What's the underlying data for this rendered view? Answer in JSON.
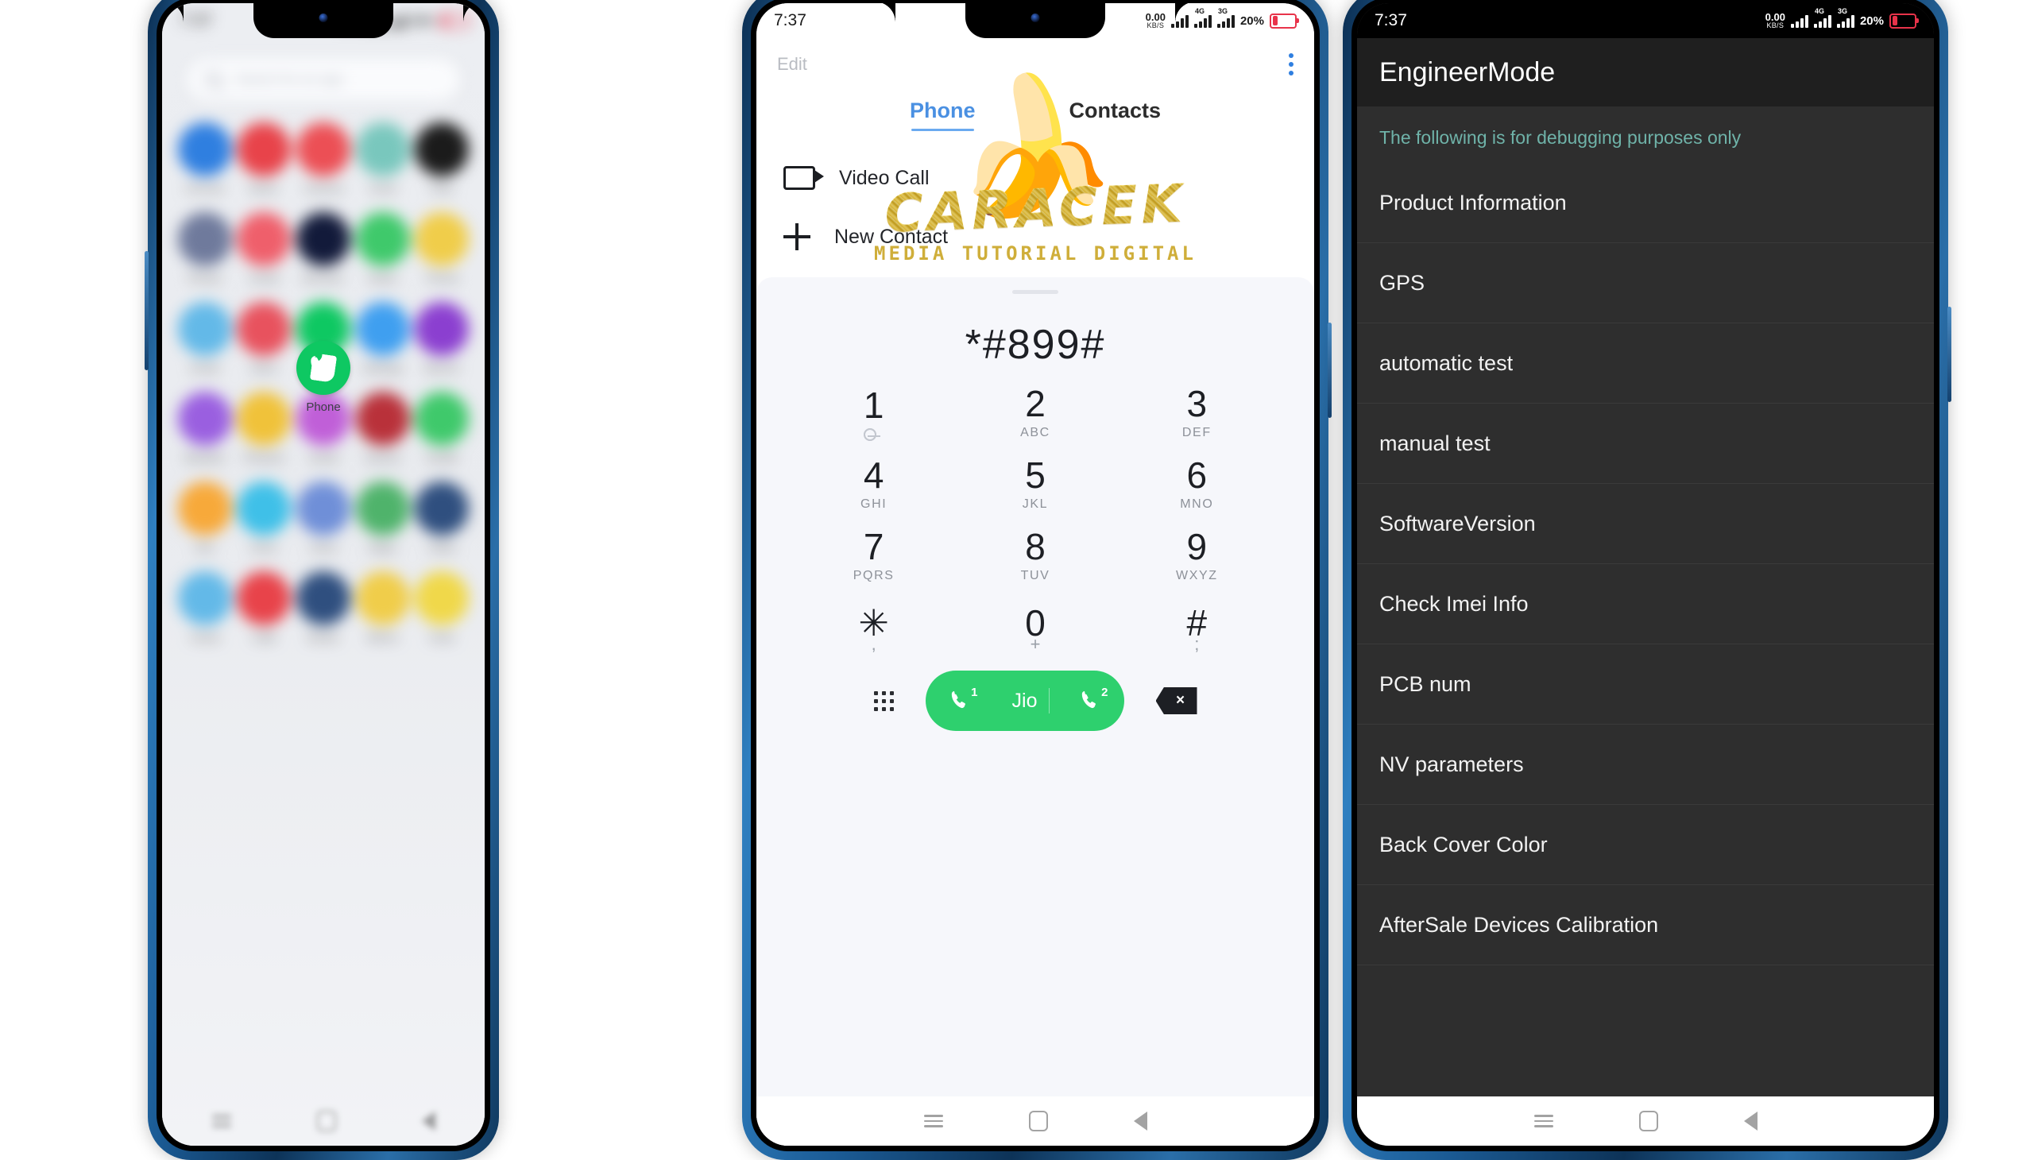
{
  "statusbar": {
    "time": "7:37",
    "data_rate_value": "0.00",
    "data_rate_unit": "KB/S",
    "battery_percent": "20%",
    "icons": [
      "data-speed-icon",
      "mobile-data-icon",
      "signal-sim1-icon",
      "signal-sim2-icon",
      "battery-icon"
    ],
    "signal1_gen": "4G",
    "signal2_gen": "3G"
  },
  "phone1": {
    "name": "app-drawer",
    "search_placeholder": "Search for an app",
    "apps": [
      {
        "label": "Chrome",
        "color": "#2f7fe0"
      },
      {
        "label": "Music",
        "color": "#e8434a"
      },
      {
        "label": "Camera",
        "color": "#ec4f55"
      },
      {
        "label": "Clock",
        "color": "#79c7bd"
      },
      {
        "label": "Files",
        "color": "#1b1b1b"
      },
      {
        "label": "Photos",
        "color": "#6f7a9c"
      },
      {
        "label": "Gmail",
        "color": "#ef5f6b"
      },
      {
        "label": "Browser",
        "color": "#121a3a"
      },
      {
        "label": "Notes",
        "color": "#3fc96b"
      },
      {
        "label": "Theme",
        "color": "#f0cd4a"
      },
      {
        "label": "Email",
        "color": "#63b9e8"
      },
      {
        "label": "Store",
        "color": "#e8525e"
      },
      {
        "label": "Phone",
        "color": "#0ec862"
      },
      {
        "label": "Settings",
        "color": "#3f9ff0"
      },
      {
        "label": "Music2",
        "color": "#8b3fd0"
      },
      {
        "label": "Weather",
        "color": "#9a5fe0"
      },
      {
        "label": "Photos2",
        "color": "#f0c23a"
      },
      {
        "label": "Assist",
        "color": "#c05fd8"
      },
      {
        "label": "Games",
        "color": "#b9313a"
      },
      {
        "label": "Health",
        "color": "#3fc96b"
      },
      {
        "label": "Sun",
        "color": "#f7a93a"
      },
      {
        "label": "Drive",
        "color": "#3fc0e8"
      },
      {
        "label": "Voice",
        "color": "#6f8fd8"
      },
      {
        "label": "Maps",
        "color": "#4fb36b"
      },
      {
        "label": "Video",
        "color": "#2f4f7f"
      },
      {
        "label": "Cloud",
        "color": "#63b9e8"
      },
      {
        "label": "Calls",
        "color": "#e8434a"
      },
      {
        "label": "Books",
        "color": "#2f4f7f"
      },
      {
        "label": "Memo",
        "color": "#f0cd4a"
      },
      {
        "label": "Scan",
        "color": "#f0d84a"
      }
    ],
    "focused_app": "Phone"
  },
  "phone2": {
    "name": "dialer",
    "edit_label": "Edit",
    "overflow_label": "more-options",
    "tabs": [
      {
        "label": "Phone",
        "active": true
      },
      {
        "label": "Contacts",
        "active": false
      }
    ],
    "quick_actions": [
      {
        "icon": "video-call-icon",
        "label": "Video Call"
      },
      {
        "icon": "plus-icon",
        "label": "New Contact"
      }
    ],
    "dialed_number": "*#899#",
    "keys": [
      {
        "num": "1",
        "sub": "",
        "vm": true
      },
      {
        "num": "2",
        "sub": "ABC",
        "vm": false
      },
      {
        "num": "3",
        "sub": "DEF",
        "vm": false
      },
      {
        "num": "4",
        "sub": "GHI",
        "vm": false
      },
      {
        "num": "5",
        "sub": "JKL",
        "vm": false
      },
      {
        "num": "6",
        "sub": "MNO",
        "vm": false
      },
      {
        "num": "7",
        "sub": "PQRS",
        "vm": false
      },
      {
        "num": "8",
        "sub": "TUV",
        "vm": false
      },
      {
        "num": "9",
        "sub": "WXYZ",
        "vm": false
      },
      {
        "num": "✳",
        "sub": ",",
        "vm": false
      },
      {
        "num": "0",
        "sub": "+",
        "vm": false
      },
      {
        "num": "#",
        "sub": ";",
        "vm": false
      }
    ],
    "call_button": {
      "label": "Jio",
      "sim1": "1",
      "sim2": "2",
      "color": "#2ed06e"
    },
    "dialpad_toggle": "dialpad-icon",
    "backspace": "backspace-icon",
    "watermark": {
      "brand": "CARACEK",
      "tagline": "MEDIA TUTORIAL DIGITAL",
      "emoji": "🍌"
    }
  },
  "phone3": {
    "name": "engineer-mode",
    "title": "EngineerMode",
    "note": "The following is for debugging purposes only",
    "note_color": "#6fb3a9",
    "items": [
      "Product Information",
      "GPS",
      "automatic test",
      "manual test",
      "SoftwareVersion",
      "Check Imei Info",
      "PCB num",
      "NV parameters",
      "Back Cover Color",
      "AfterSale Devices Calibration"
    ]
  },
  "navbar": {
    "recents": "recents-icon",
    "home": "home-icon",
    "back": "back-icon"
  }
}
